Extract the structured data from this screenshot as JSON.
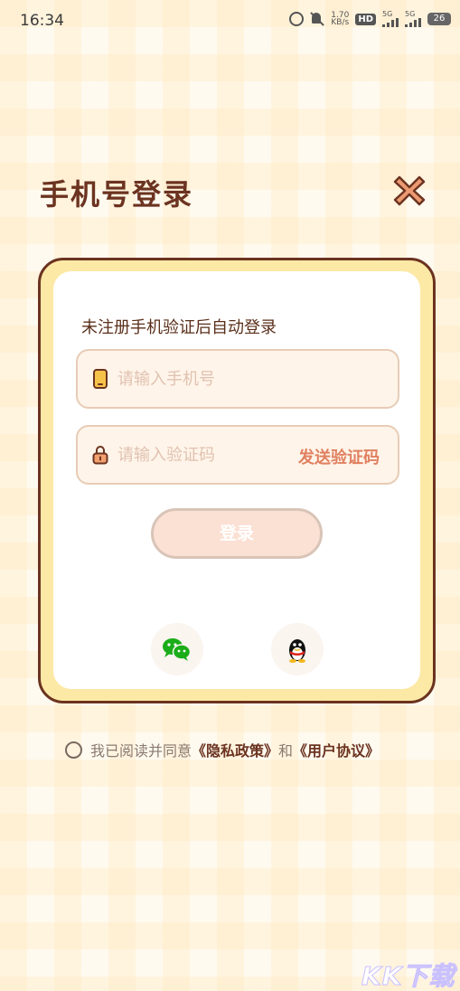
{
  "status_bar": {
    "time": "16:34",
    "speed_value": "1.70",
    "speed_unit": "KB/s",
    "hd_label": "HD",
    "sim1_label": "5G",
    "sim2_label": "5G",
    "battery_level": "26"
  },
  "header": {
    "title": "手机号登录"
  },
  "card": {
    "hint": "未注册手机验证后自动登录",
    "phone_placeholder": "请输入手机号",
    "code_placeholder": "请输入验证码",
    "send_code_label": "发送验证码",
    "login_label": "登录"
  },
  "social_login": {
    "items": [
      {
        "icon": "wechat-icon",
        "color": "#1aad19"
      },
      {
        "icon": "qq-penguin-icon",
        "color": "#111111"
      }
    ]
  },
  "agreement": {
    "prefix": "我已阅读并同意",
    "privacy_link": "《隐私政策》",
    "joiner": "和",
    "terms_link": "《用户协议》"
  },
  "watermark": {
    "text": "KK下载"
  },
  "colors": {
    "title_brown": "#6b3320",
    "card_border": "#6b3320",
    "card_fill": "#fde9a6",
    "accent_orange": "#e08060",
    "close_icon_fill": "#ec9a72"
  }
}
